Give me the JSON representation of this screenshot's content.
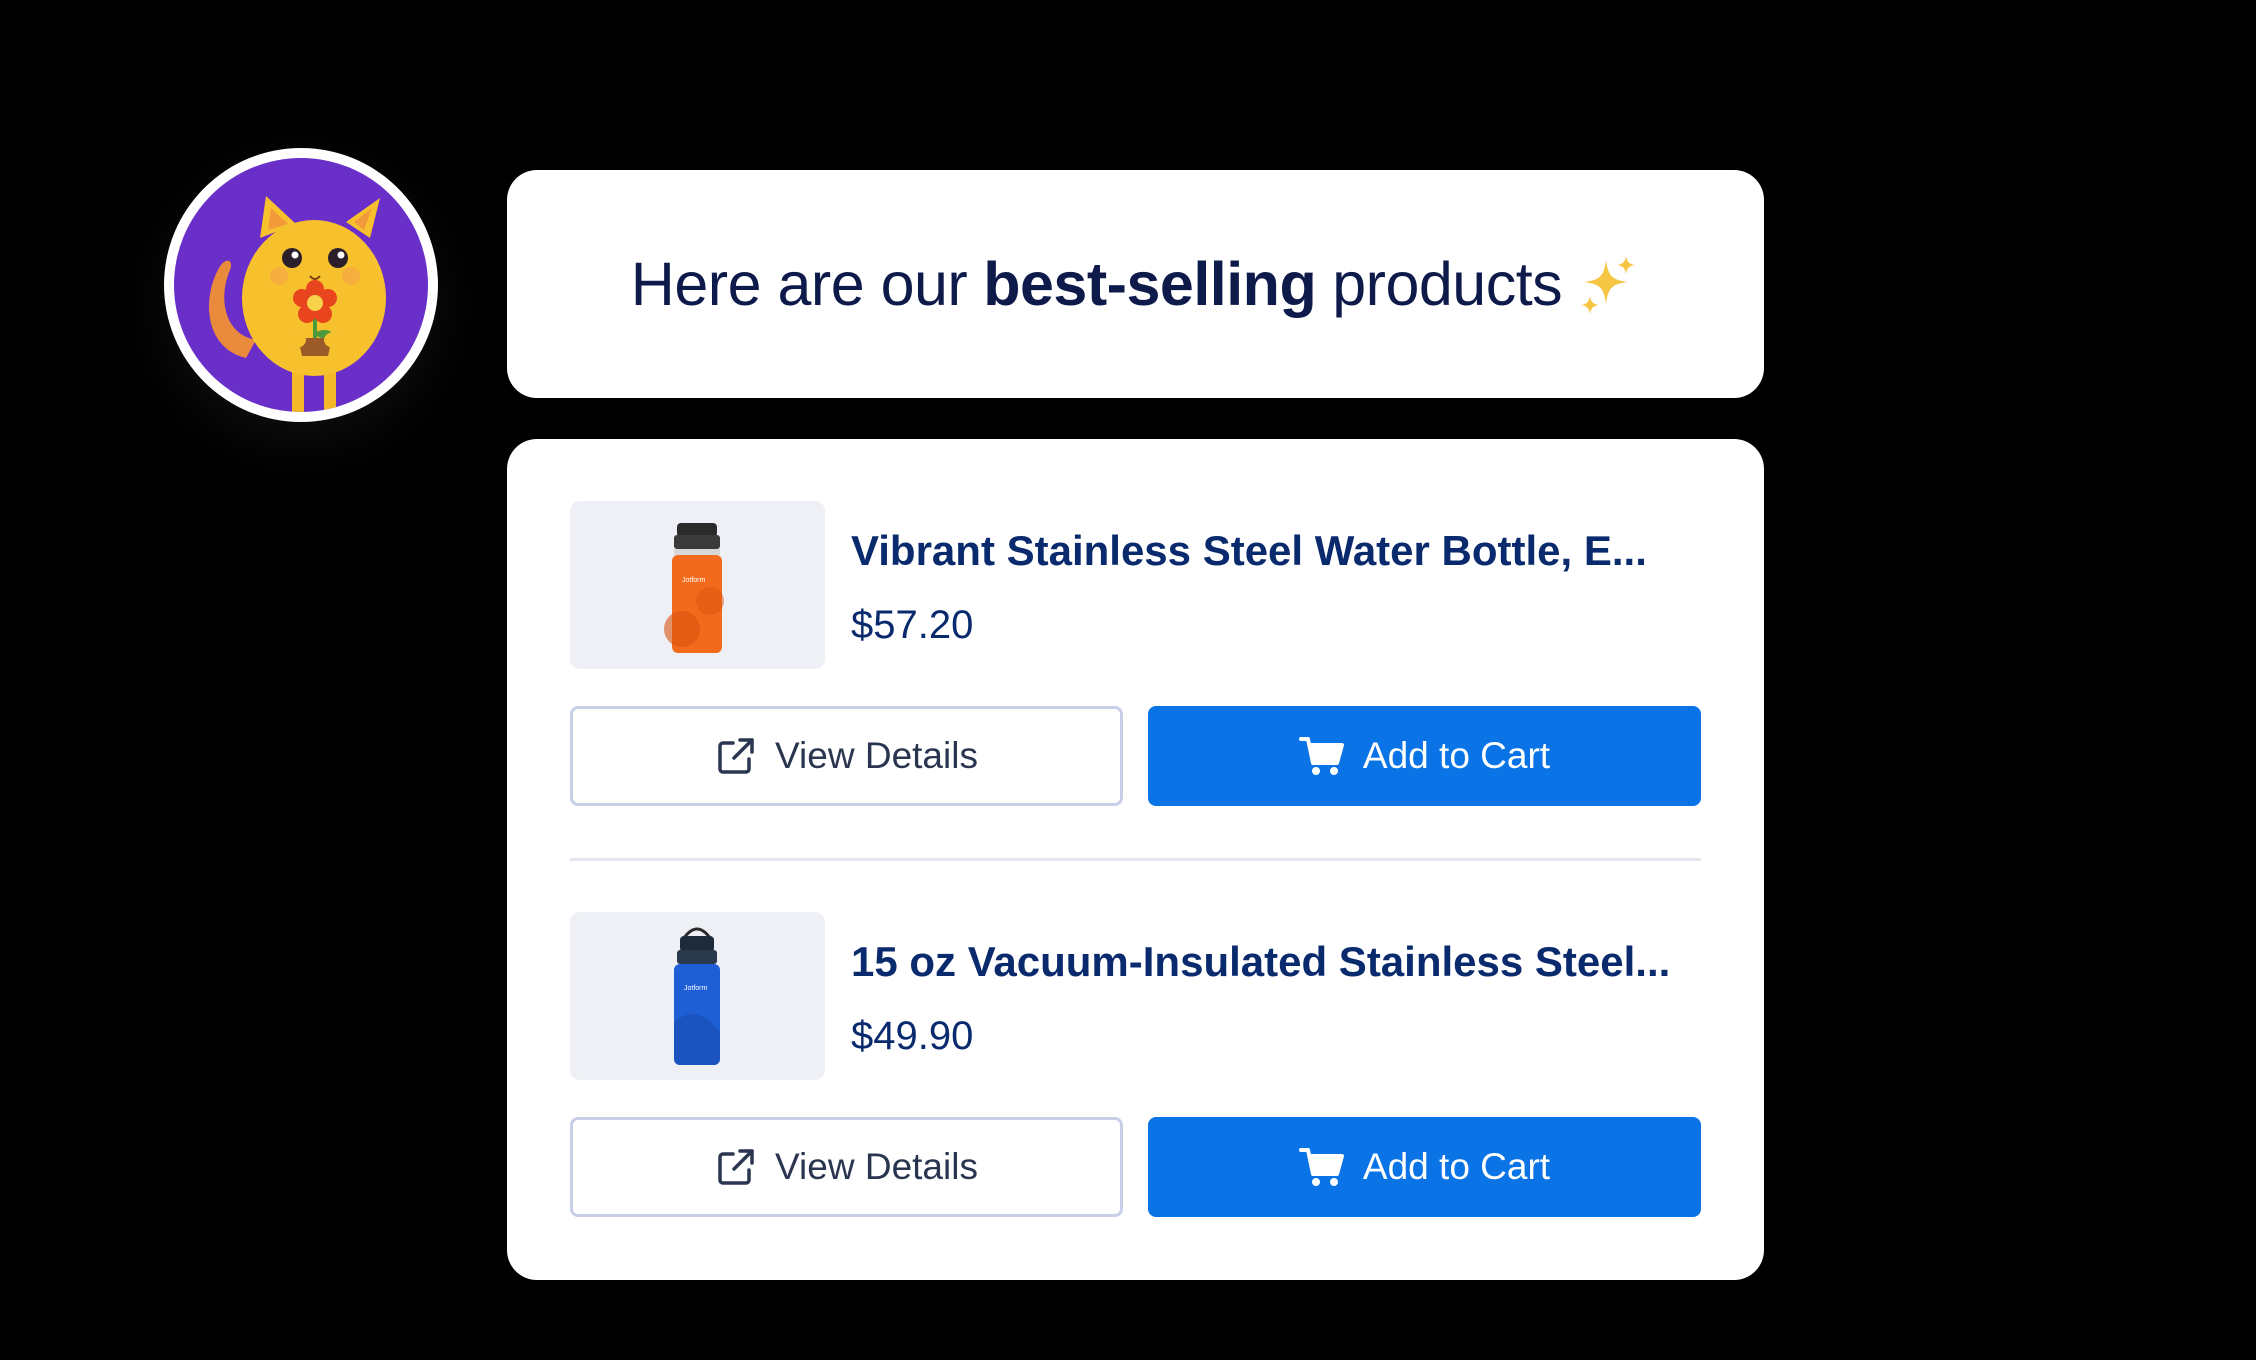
{
  "assistant": {
    "avatar_icon": "cat-mascot-holding-flower",
    "message_prefix": "Here are our",
    "message_bold": "best-selling",
    "message_suffix": "products",
    "emoji": "sparkles"
  },
  "products": [
    {
      "title": "Vibrant Stainless Steel Water Bottle, E...",
      "price": "$57.20",
      "image_icon": "orange-water-bottle",
      "view_label": "View Details",
      "cart_label": "Add to Cart"
    },
    {
      "title": "15 oz Vacuum-Insulated Stainless Steel...",
      "price": "$49.90",
      "image_icon": "blue-water-bottle",
      "view_label": "View Details",
      "cart_label": "Add to Cart"
    }
  ],
  "colors": {
    "primary": "#0a74e6",
    "text_dark": "#0a2a6e",
    "avatar_bg": "#6a2ec9"
  }
}
